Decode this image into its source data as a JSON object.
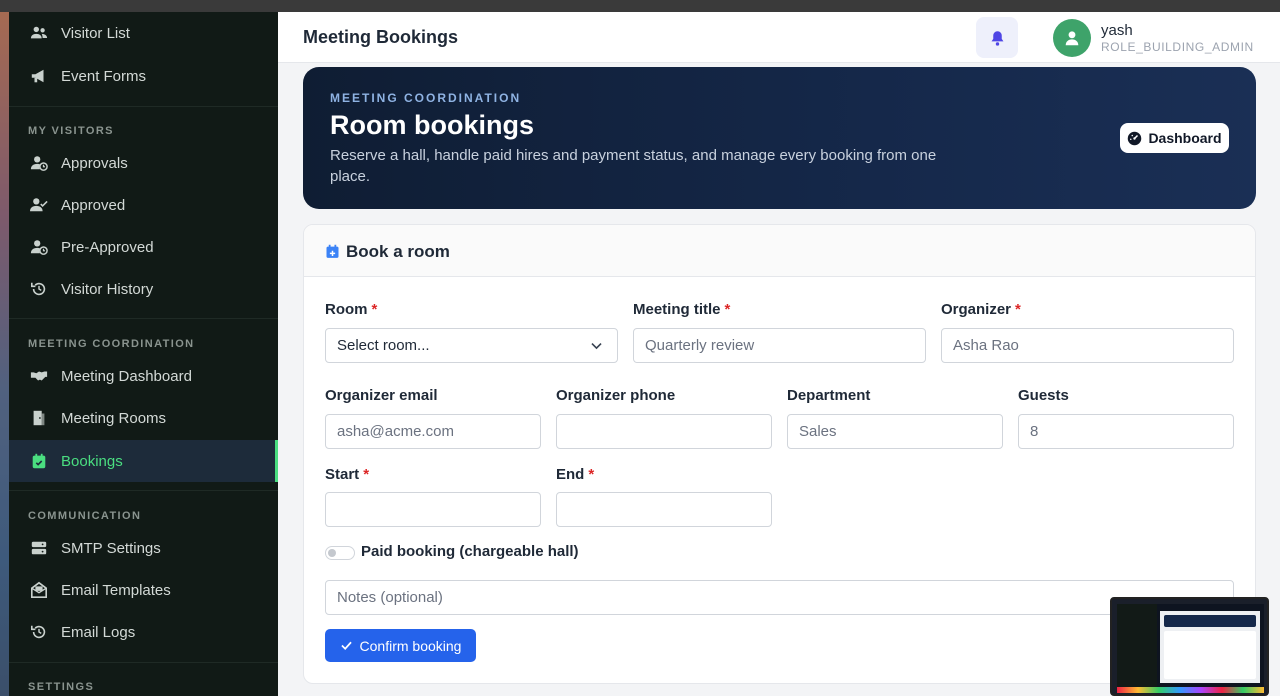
{
  "sidebar": {
    "items": [
      {
        "label": "Visitor List"
      },
      {
        "label": "Event Forms"
      },
      {
        "label": "Approvals"
      },
      {
        "label": "Approved"
      },
      {
        "label": "Pre-Approved"
      },
      {
        "label": "Visitor History"
      },
      {
        "label": "Meeting Dashboard"
      },
      {
        "label": "Meeting Rooms"
      },
      {
        "label": "Bookings"
      },
      {
        "label": "SMTP Settings"
      },
      {
        "label": "Email Templates"
      },
      {
        "label": "Email Logs"
      }
    ],
    "sections": {
      "my_visitors": "MY VISITORS",
      "meeting_coordination": "MEETING COORDINATION",
      "communication": "COMMUNICATION",
      "settings": "SETTINGS"
    },
    "active_item": "Bookings"
  },
  "header": {
    "title": "Meeting Bookings",
    "user_name": "yash",
    "user_role": "ROLE_BUILDING_ADMIN"
  },
  "hero": {
    "eyebrow": "MEETING COORDINATION",
    "title": "Room bookings",
    "description": "Reserve a hall, handle paid hires and payment status, and manage every booking from one place.",
    "dashboard_button": "Dashboard"
  },
  "form": {
    "title": "Book a room",
    "required_mark": "*",
    "room": {
      "label": "Room",
      "value": "Select room..."
    },
    "meeting_title": {
      "label": "Meeting title",
      "placeholder": "Quarterly review"
    },
    "organizer": {
      "label": "Organizer",
      "placeholder": "Asha Rao"
    },
    "organizer_email": {
      "label": "Organizer email",
      "placeholder": "asha@acme.com"
    },
    "organizer_phone": {
      "label": "Organizer phone",
      "placeholder": ""
    },
    "department": {
      "label": "Department",
      "placeholder": "Sales"
    },
    "guests": {
      "label": "Guests",
      "placeholder": "8"
    },
    "start": {
      "label": "Start",
      "value": ""
    },
    "end": {
      "label": "End",
      "value": ""
    },
    "paid_booking": {
      "label": "Paid booking (chargeable hall)",
      "checked": false
    },
    "notes": {
      "placeholder": "Notes (optional)"
    },
    "confirm_button": "Confirm booking"
  },
  "colors": {
    "sidebar_bg": "#111a16",
    "active_accent": "#4ade80",
    "hero_bg": "#15284a",
    "primary_button": "#2563eb",
    "required": "#dc2626",
    "avatar": "#3ea36a"
  }
}
